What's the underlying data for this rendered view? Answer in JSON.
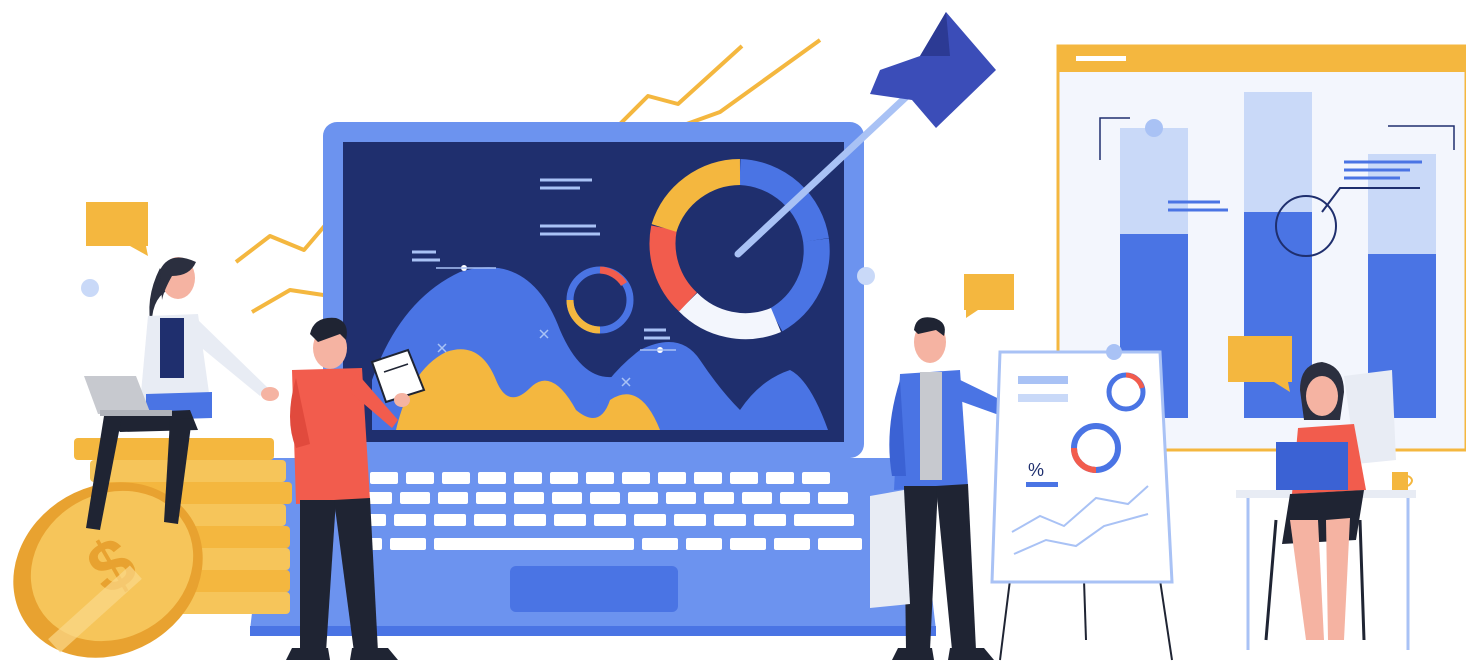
{
  "illustration": {
    "flipchart": {
      "percent_symbol": "%"
    },
    "coin": {
      "currency_symbol": "$"
    }
  },
  "colors": {
    "navy": "#1f2f6e",
    "blue": "#4a74e4",
    "light_blue": "#a9c2f5",
    "pale_blue": "#dde7fb",
    "yellow": "#f4b73f",
    "red": "#f25c4d",
    "skin": "#f5b3a2",
    "dark": "#1f2433"
  }
}
